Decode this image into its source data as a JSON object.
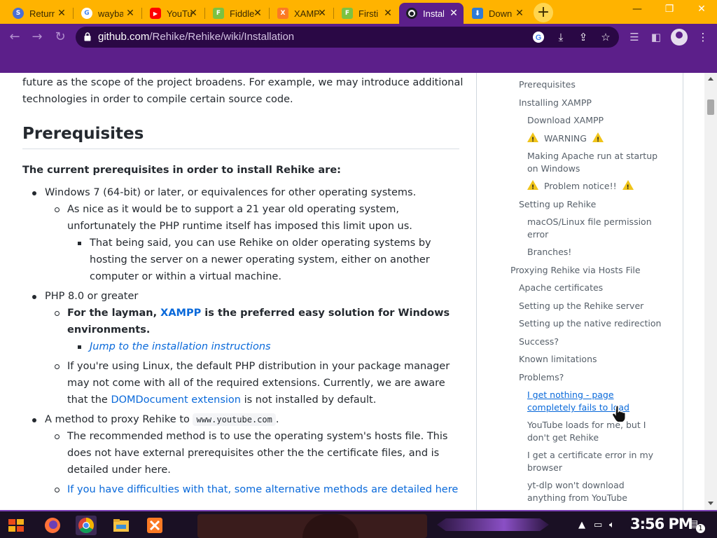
{
  "browser": {
    "tabs": [
      {
        "title": "Return",
        "favicon": "bookmark-icon",
        "color": "#4a6fd4",
        "glyph": "S"
      },
      {
        "title": "wayback",
        "favicon": "google-icon",
        "color": "#ffffff",
        "glyph": "G"
      },
      {
        "title": "YouTube",
        "favicon": "youtube-icon",
        "color": "#ff0000",
        "glyph": "▶"
      },
      {
        "title": "Fiddler",
        "favicon": "fiddler-icon",
        "color": "#7cc242",
        "glyph": "F"
      },
      {
        "title": "XAMPP",
        "favicon": "xampp-icon",
        "color": "#fb7a24",
        "glyph": "X"
      },
      {
        "title": "Firsti",
        "favicon": "fiddler-icon",
        "color": "#7cc242",
        "glyph": "F"
      },
      {
        "title": "Installation",
        "favicon": "github-icon",
        "color": "#1b1f24",
        "glyph": "●",
        "active": true
      },
      {
        "title": "Down",
        "favicon": "download-icon",
        "color": "#2e7bd6",
        "glyph": "⬇"
      }
    ],
    "new_tab_label": "+",
    "close_glyph": "✕",
    "window_controls": {
      "minimize": "—",
      "restore": "❐",
      "close": "✕"
    },
    "url": {
      "domain": "github.com",
      "path": "/Rehike/Rehike/wiki/Installation"
    },
    "accent": "#5c1f8a",
    "tabstrip_color": "#ffb300"
  },
  "article": {
    "intro": "future as the scope of the project broadens. For example, we may introduce additional technologies in order to compile certain source code.",
    "heading": "Prerequisites",
    "lead": "The current prerequisites in order to install Rehike are:",
    "items": {
      "win": "Windows 7 (64-bit) or later, or equivalences for other operating systems.",
      "win_sub": "As nice as it would be to support a 21 year old operating system, unfortunately the PHP runtime itself has imposed this limit upon us.",
      "win_sub2": "That being said, you can use Rehike on older operating systems by hosting the server on a newer operating system, either on another computer or within a virtual machine.",
      "php": "PHP 8.0 or greater",
      "php_layman_a": "For the layman, ",
      "php_layman_link": "XAMPP",
      "php_layman_b": " is the preferred easy solution for Windows environments.",
      "php_jump": "Jump to the installation instructions",
      "php_linux_a": "If you're using Linux, the default PHP distribution in your package manager may not come with all of the required extensions. Currently, we are aware that the ",
      "php_linux_link": "DOMDocument extension",
      "php_linux_b": " is not installed by default.",
      "proxy_a": "A method to proxy Rehike to ",
      "proxy_code": "www.youtube.com",
      "proxy_b": ".",
      "proxy_sub": "The recommended method is to use the operating system's hosts file. This does not have external prerequisites other the the certificate files, and is detailed under here.",
      "proxy_alt": "If you have difficulties with that, some alternative methods are detailed here"
    }
  },
  "toc": {
    "items": [
      "Prerequisites",
      "Installing XAMPP",
      "Download XAMPP",
      "WARNING",
      "Making Apache run at startup on Windows",
      "Problem notice!!",
      "Setting up Rehike",
      "macOS/Linux file permission error",
      "Branches!",
      "Proxying Rehike via Hosts File",
      "Apache certificates",
      "Setting up the Rehike server",
      "Setting up the native redirection",
      "Success?",
      "Known limitations",
      "Problems?",
      "I get nothing - page completely fails to load",
      "YouTube loads for me, but I don't get Rehike",
      "I get a certificate error in my browser",
      "yt-dlp won't download anything from YouTube"
    ]
  },
  "taskbar": {
    "clock": "3:56 PM",
    "notification_count": "1"
  }
}
